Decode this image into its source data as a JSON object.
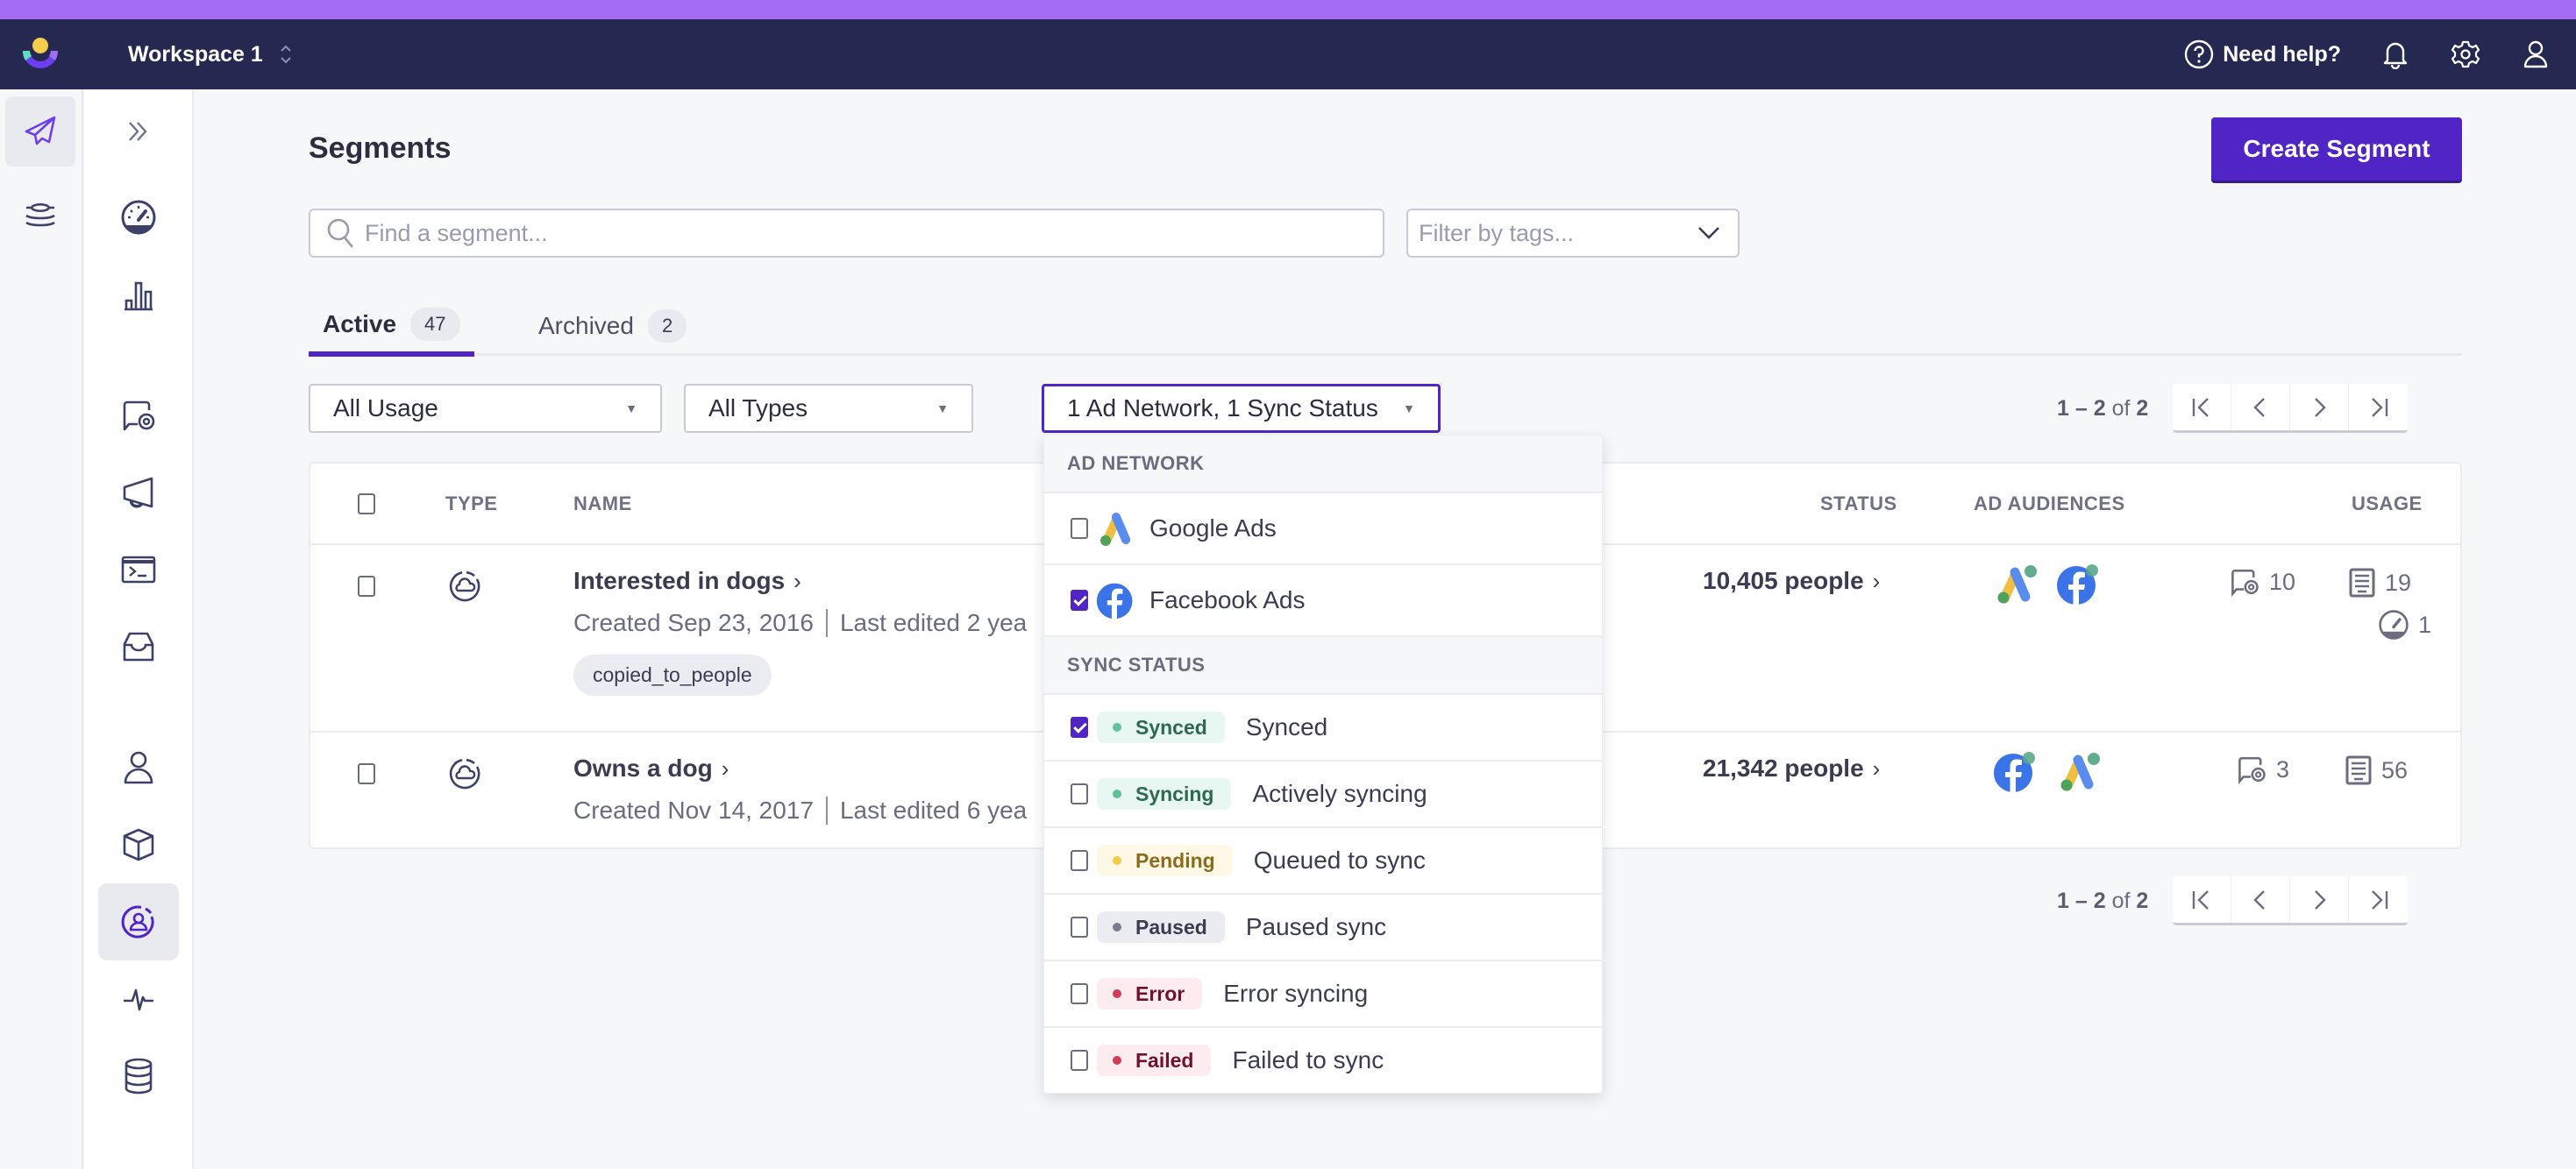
{
  "topnav": {
    "workspace": "Workspace 1",
    "help_label": "Need help?"
  },
  "colors": {
    "accent": "#5024c5",
    "nav_bg": "#252850",
    "top_strip": "#a36cf3"
  },
  "rail": {
    "items": [
      {
        "icon": "paper-plane-icon",
        "active": true
      },
      {
        "icon": "layers-icon",
        "active": false
      }
    ]
  },
  "sidenav": {
    "items": [
      {
        "icon": "expand-chevrons-icon"
      },
      {
        "icon": "dashboard-gauge-icon"
      },
      {
        "icon": "bar-chart-icon"
      },
      {
        "icon": "message-target-icon"
      },
      {
        "icon": "megaphone-icon"
      },
      {
        "icon": "terminal-icon"
      },
      {
        "icon": "inbox-icon"
      },
      {
        "icon": "person-icon"
      },
      {
        "icon": "cube-icon"
      },
      {
        "icon": "segment-person-icon",
        "active": true
      },
      {
        "icon": "activity-pulse-icon"
      },
      {
        "icon": "database-icon"
      }
    ]
  },
  "page": {
    "title": "Segments",
    "create_button": "Create Segment",
    "search_placeholder": "Find a segment...",
    "tags_placeholder": "Filter by tags..."
  },
  "tabs": [
    {
      "label": "Active",
      "count": "47",
      "active": true
    },
    {
      "label": "Archived",
      "count": "2",
      "active": false
    }
  ],
  "filters": {
    "usage": "All Usage",
    "types": "All Types",
    "ad_network": "1 Ad Network, 1 Sync Status"
  },
  "pagination": {
    "start": "1",
    "dash": "–",
    "end": "2",
    "of": "of",
    "total": "2"
  },
  "table": {
    "headers": {
      "type": "TYPE",
      "name": "NAME",
      "status": "STATUS",
      "ad_audiences": "AD AUDIENCES",
      "usage": "USAGE"
    },
    "rows": [
      {
        "name": "Interested in dogs",
        "created": "Created Sep 23, 2016",
        "edited": "Last edited 2 yea",
        "tag": "copied_to_people",
        "people": "10,405 people",
        "audiences": [
          "google-ads",
          "facebook-ads"
        ],
        "usage_messages": "10",
        "usage_campaigns": "19",
        "usage_dashboards": "1"
      },
      {
        "name": "Owns a dog",
        "created": "Created Nov 14, 2017",
        "edited": "Last edited 6 yea",
        "people": "21,342 people",
        "audiences": [
          "facebook-ads",
          "google-ads"
        ],
        "usage_messages": "3",
        "usage_campaigns": "56"
      }
    ]
  },
  "dropdown": {
    "ad_network_title": "AD NETWORK",
    "networks": [
      {
        "label": "Google Ads",
        "checked": false
      },
      {
        "label": "Facebook Ads",
        "checked": true
      }
    ],
    "sync_status_title": "SYNC STATUS",
    "statuses": [
      {
        "pill": "Synced",
        "desc": "Synced",
        "checked": true,
        "bg": "#e8f7f1",
        "fg": "#2d6a4f",
        "dot": "#5fc29a"
      },
      {
        "pill": "Syncing",
        "desc": "Actively syncing",
        "checked": false,
        "bg": "#e8f7f1",
        "fg": "#2d6a4f",
        "dot": "#5fc29a"
      },
      {
        "pill": "Pending",
        "desc": "Queued to sync",
        "checked": false,
        "bg": "#fff8e6",
        "fg": "#8a6d1c",
        "dot": "#f4cd45"
      },
      {
        "pill": "Paused",
        "desc": "Paused sync",
        "checked": false,
        "bg": "#ebecf1",
        "fg": "#3b3b52",
        "dot": "#7a7b8e"
      },
      {
        "pill": "Error",
        "desc": "Error syncing",
        "checked": false,
        "bg": "#fdecef",
        "fg": "#6e1230",
        "dot": "#d23c56"
      },
      {
        "pill": "Failed",
        "desc": "Failed to sync",
        "checked": false,
        "bg": "#fdecef",
        "fg": "#6e1230",
        "dot": "#d23c56"
      }
    ]
  }
}
